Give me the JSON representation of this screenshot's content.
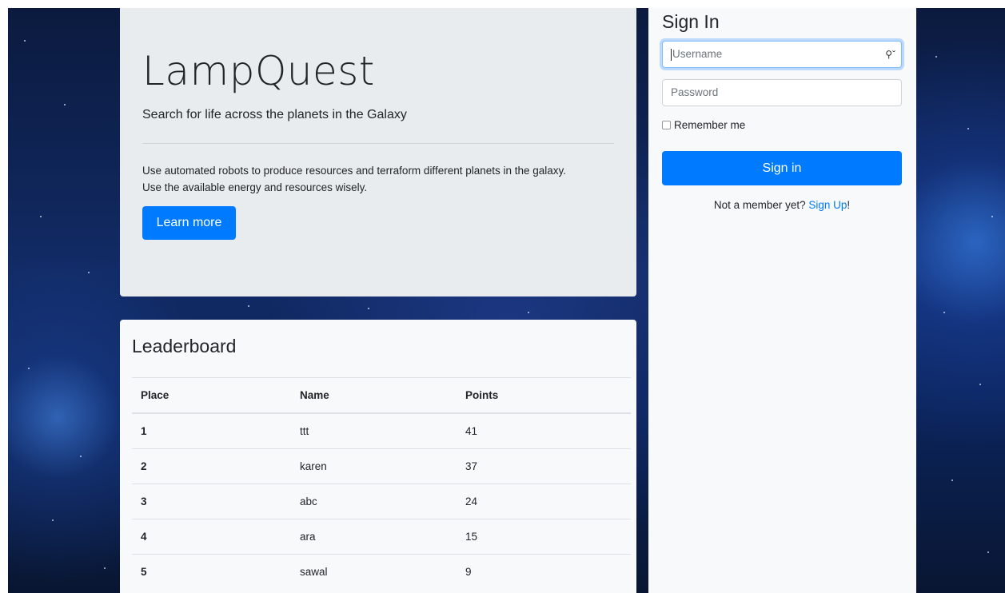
{
  "hero": {
    "title": "LampQuest",
    "subtitle": "Search for life across the planets in the Galaxy",
    "description_line1": "Use automated robots to produce resources and terraform different planets in the galaxy.",
    "description_line2": "Use the available energy and resources wisely.",
    "learn_more_label": "Learn more"
  },
  "leaderboard": {
    "title": "Leaderboard",
    "columns": [
      "Place",
      "Name",
      "Points"
    ],
    "rows": [
      {
        "place": "1",
        "name": "ttt",
        "points": "41"
      },
      {
        "place": "2",
        "name": "karen",
        "points": "37"
      },
      {
        "place": "3",
        "name": "abc",
        "points": "24"
      },
      {
        "place": "4",
        "name": "ara",
        "points": "15"
      },
      {
        "place": "5",
        "name": "sawal",
        "points": "9"
      }
    ]
  },
  "signin": {
    "title": "Sign In",
    "username_placeholder": "Username",
    "password_placeholder": "Password",
    "remember_label": "Remember me",
    "button_label": "Sign in",
    "not_member_text": "Not a member yet? ",
    "signup_link": "Sign Up",
    "signup_suffix": "!"
  },
  "icons": {
    "password_manager": "key-icon"
  },
  "colors": {
    "primary": "#007bff",
    "panel": "#e9ecef",
    "card": "#f8f9fa"
  }
}
